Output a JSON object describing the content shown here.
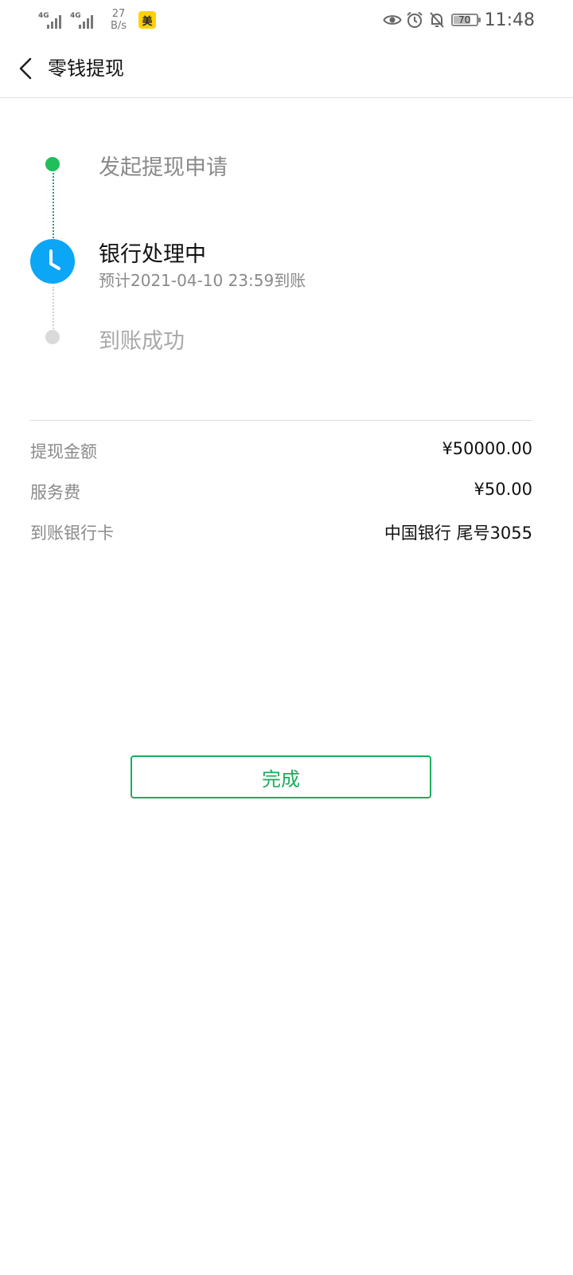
{
  "status_bar": {
    "signal1_label": "4G",
    "signal2_label": "4G",
    "net_speed_value": "27",
    "net_speed_unit": "B/s",
    "app_badge": "美",
    "battery": "70",
    "time": "11:48",
    "icons": [
      "eye-icon",
      "alarm-icon",
      "bell-off-icon",
      "battery-icon"
    ]
  },
  "nav": {
    "title": "零钱提现",
    "back_icon": "chevron-left-icon"
  },
  "timeline": {
    "steps": [
      {
        "label": "发起提现申请",
        "state": "done"
      },
      {
        "label": "银行处理中",
        "state": "current",
        "sub": "预计2021-04-10 23:59到账"
      },
      {
        "label": "到账成功",
        "state": "pending"
      }
    ],
    "colors": {
      "done": "#1fbf5c",
      "current": "#0ba6f6",
      "pending": "#dadada"
    }
  },
  "details": [
    {
      "label": "提现金额",
      "value": "¥50000.00"
    },
    {
      "label": "服务费",
      "value": "¥50.00"
    },
    {
      "label": "到账银行卡",
      "value": "中国银行 尾号3055"
    }
  ],
  "done_button": {
    "label": "完成",
    "color": "#1aad5c"
  }
}
